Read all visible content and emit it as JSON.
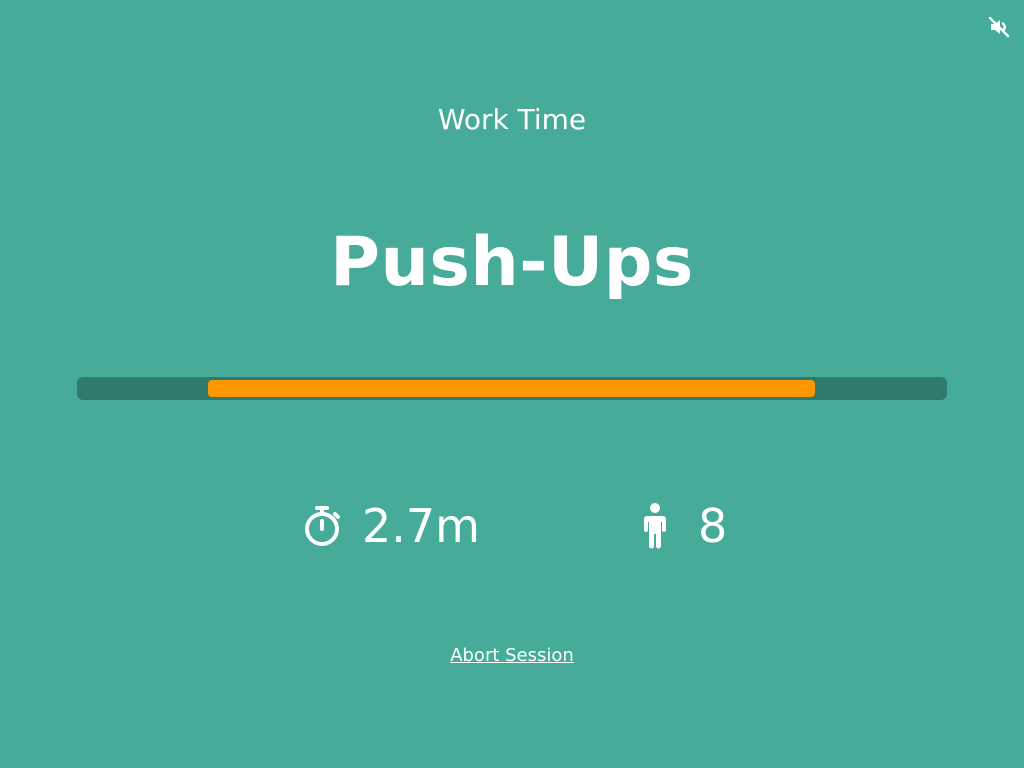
{
  "controls": {
    "mute_icon": "speaker-muted-icon"
  },
  "session": {
    "phase_label": "Work Time",
    "exercise_name": "Push-Ups",
    "progress": {
      "start_fraction": 0.151,
      "end_fraction": 0.848,
      "fill_color": "#ff9800",
      "track_color": "#2f7a6c"
    },
    "time_icon": "stopwatch-icon",
    "time_value": "2.7m",
    "reps_icon": "person-icon",
    "reps_value": "8",
    "abort_label": "Abort Session"
  },
  "colors": {
    "background": "#46ab99",
    "text": "#ffffff"
  }
}
